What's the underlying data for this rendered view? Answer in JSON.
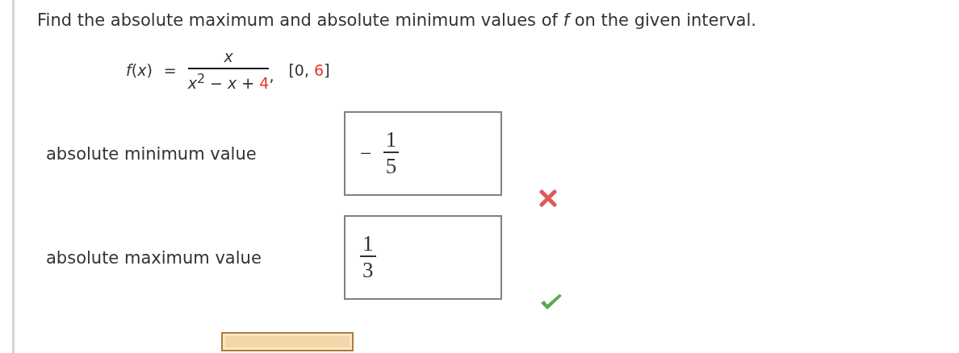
{
  "question": {
    "prompt": "Find the absolute maximum and absolute minimum values of *f* on the given interval.",
    "formula": {
      "lhs": "*f*(*x*)",
      "equals": "=",
      "numerator": "*x*",
      "denominator": [
        {
          "text": "*x*$^{2}$ − *x* + ",
          "highlighted": false
        },
        {
          "text": "4",
          "highlighted": true
        }
      ],
      "separator": ",",
      "interval": [
        {
          "text": "[0, ",
          "highlighted": false
        },
        {
          "text": "6",
          "highlighted": true
        },
        {
          "text": "]",
          "highlighted": false
        }
      ]
    }
  },
  "answers": [
    {
      "label": "absolute minimum value",
      "sign": "−",
      "numerator": "1",
      "denominator": "5",
      "correct": false
    },
    {
      "label": "absolute maximum value",
      "numerator": "1",
      "denominator": "3",
      "correct": true
    }
  ]
}
